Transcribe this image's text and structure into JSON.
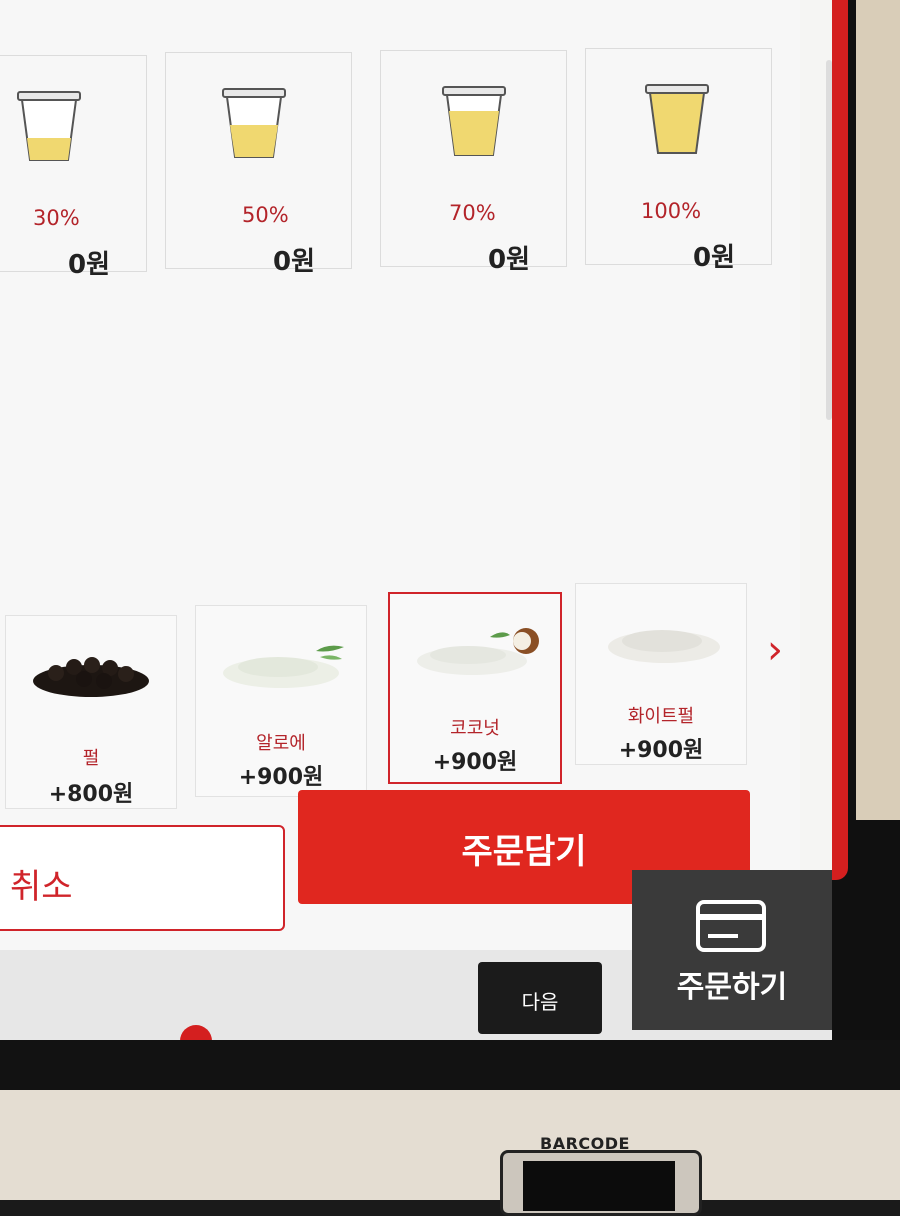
{
  "ice_options": [
    {
      "label": "30%",
      "price": "0원",
      "fill": 0.3
    },
    {
      "label": "50%",
      "price": "0원",
      "fill": 0.5
    },
    {
      "label": "70%",
      "price": "0원",
      "fill": 0.7
    },
    {
      "label": "100%",
      "price": "0원",
      "fill": 1.0
    }
  ],
  "toppings": [
    {
      "name": "펄",
      "price": "+800원",
      "image": "tapioca-pearl",
      "selected": false
    },
    {
      "name": "알로에",
      "price": "+900원",
      "image": "aloe",
      "selected": false
    },
    {
      "name": "코코넛",
      "price": "+900원",
      "image": "coconut",
      "selected": true
    },
    {
      "name": "화이트펄",
      "price": "+900원",
      "image": "white-pearl",
      "selected": false
    }
  ],
  "nav": {
    "next_arrow_icon": "chevron-right-icon"
  },
  "actions": {
    "cancel_label": "취소",
    "add_to_cart_label": "주문담기"
  },
  "footer": {
    "next_label": "다음",
    "order_label": "주문하기",
    "order_icon": "credit-card-icon"
  },
  "hardware": {
    "barcode_label": "BARCODE"
  },
  "colors": {
    "accent": "#e0271f",
    "label_red": "#b3242a",
    "ice_fill": "#f0d870"
  }
}
